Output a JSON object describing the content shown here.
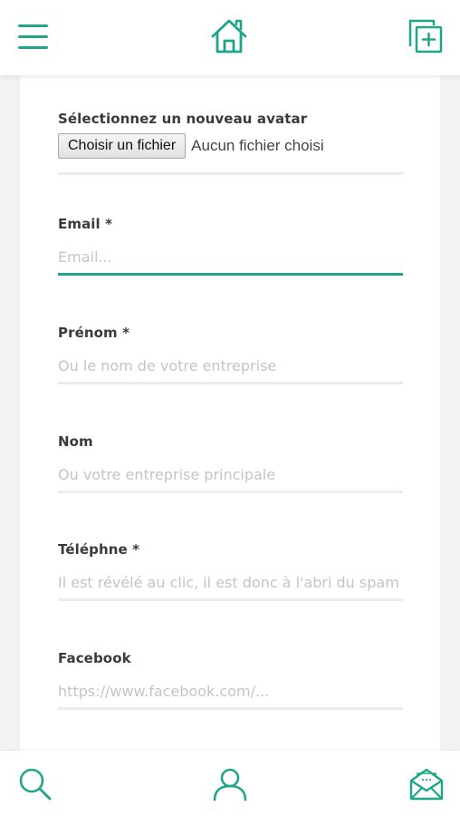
{
  "header": {
    "menu_icon": "hamburger-menu-icon",
    "home_icon": "home-icon",
    "add_icon": "add-copy-icon"
  },
  "form": {
    "avatar": {
      "label": "Sélectionnez un nouveau avatar",
      "button_label": "Choisir un fichier",
      "status": "Aucun fichier choisi"
    },
    "email": {
      "label": "Email *",
      "placeholder": "Email...",
      "value": ""
    },
    "prenom": {
      "label": "Prénom *",
      "placeholder": "Ou le nom de votre entreprise",
      "value": ""
    },
    "nom": {
      "label": "Nom",
      "placeholder": "Ou votre entreprise principale",
      "value": ""
    },
    "telephone": {
      "label": "Téléphne *",
      "placeholder": "Il est révélé au clic, il est donc à l'abri du spam",
      "value": ""
    },
    "facebook": {
      "label": "Facebook",
      "placeholder": "https://www.facebook.com/...",
      "value": ""
    }
  },
  "bottom_nav": {
    "search_icon": "search-icon",
    "profile_icon": "user-icon",
    "messages_icon": "mail-icon"
  },
  "colors": {
    "accent": "#1ea58a",
    "background": "#f2f2f2"
  }
}
